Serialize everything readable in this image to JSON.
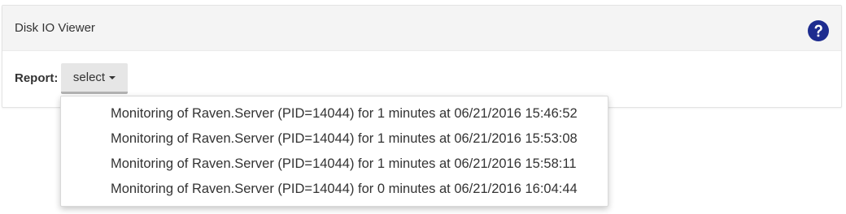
{
  "panel": {
    "title": "Disk IO Viewer",
    "help_icon": "question-circle-icon",
    "help_icon_color": "#1d2c8f"
  },
  "report": {
    "label": "Report:",
    "select_label": "select",
    "select_icon": "caret-down-icon",
    "options": [
      "Monitoring of Raven.Server (PID=14044) for 1 minutes at 06/21/2016 15:46:52",
      "Monitoring of Raven.Server (PID=14044) for 1 minutes at 06/21/2016 15:53:08",
      "Monitoring of Raven.Server (PID=14044) for 1 minutes at 06/21/2016 15:58:11",
      "Monitoring of Raven.Server (PID=14044) for 0 minutes at 06/21/2016 16:04:44"
    ]
  }
}
